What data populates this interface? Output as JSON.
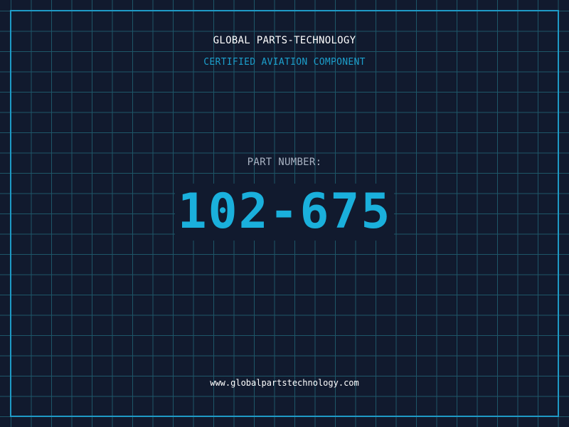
{
  "header": {
    "company": "GLOBAL PARTS-TECHNOLOGY",
    "subtitle": "CERTIFIED AVIATION COMPONENT"
  },
  "part": {
    "label": "PART NUMBER:",
    "number": "102-675"
  },
  "footer": {
    "url": "www.globalpartstechnology.com"
  },
  "colors": {
    "background": "#111a2e",
    "grid": "#1e5668",
    "frame": "#1f9ac6",
    "accent": "#1ab0dc"
  }
}
